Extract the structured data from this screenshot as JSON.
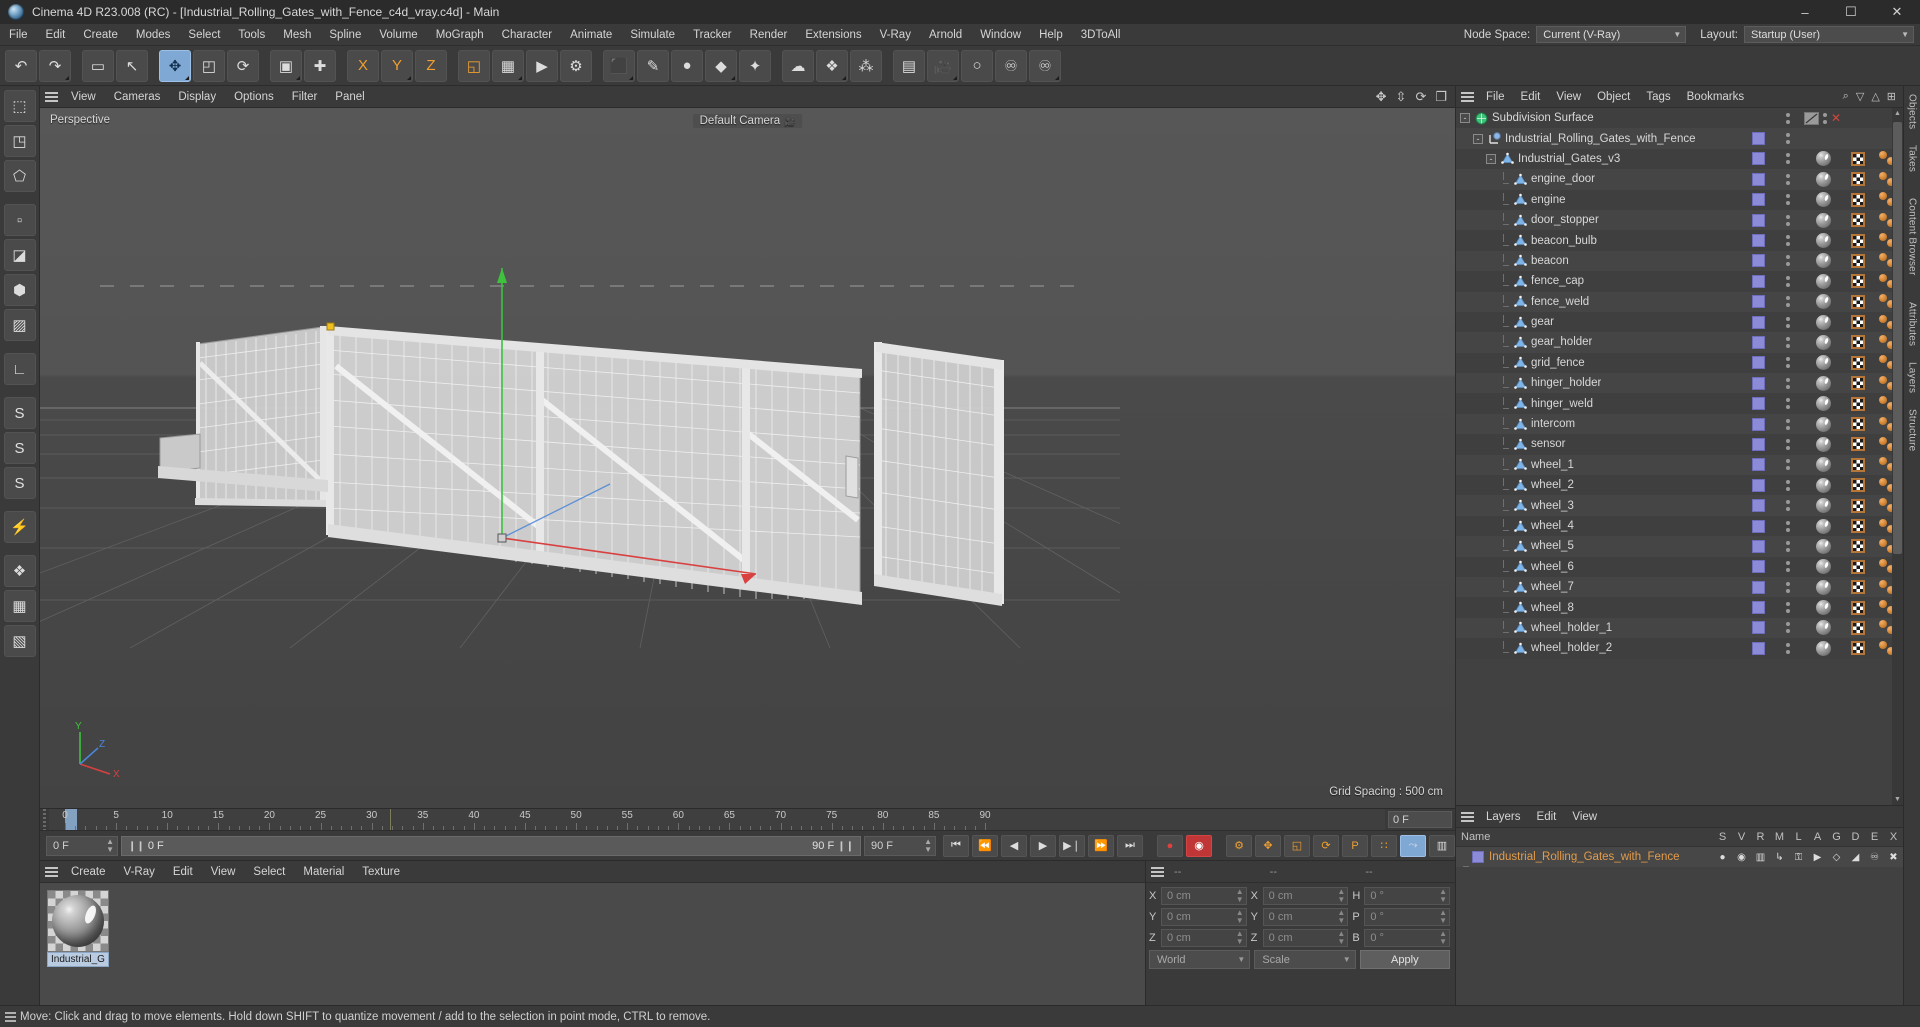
{
  "titlebar": {
    "title": "Cinema 4D R23.008 (RC) - [Industrial_Rolling_Gates_with_Fence_c4d_vray.c4d] - Main",
    "minimize": "–",
    "maximize": "☐",
    "close": "✕"
  },
  "menubar": {
    "items": [
      "File",
      "Edit",
      "Create",
      "Modes",
      "Select",
      "Tools",
      "Mesh",
      "Spline",
      "Volume",
      "MoGraph",
      "Character",
      "Animate",
      "Simulate",
      "Tracker",
      "Render",
      "Extensions",
      "V-Ray",
      "Arnold",
      "Window",
      "Help",
      "3DToAll"
    ],
    "node_space_label": "Node Space:",
    "node_space_value": "Current (V-Ray)",
    "layout_label": "Layout:",
    "layout_value": "Startup (User)"
  },
  "toolbar": {
    "buttons": [
      {
        "name": "undo-button",
        "glyph": "↶"
      },
      {
        "name": "redo-button",
        "glyph": "↷"
      },
      {
        "name": "live-selection-button",
        "glyph": "▭"
      },
      {
        "name": "cursor-select-button",
        "glyph": "↖"
      },
      {
        "name": "move-tool-button",
        "glyph": "✥"
      },
      {
        "name": "scale-tool-button",
        "glyph": "◰"
      },
      {
        "name": "rotate-tool-button",
        "glyph": "⟳"
      },
      {
        "name": "render-region-button",
        "glyph": "▣"
      },
      {
        "name": "world-axis-button",
        "glyph": "✚"
      },
      {
        "name": "x-axis-lock-button",
        "glyph": "X"
      },
      {
        "name": "y-axis-lock-button",
        "glyph": "Y"
      },
      {
        "name": "z-axis-lock-button",
        "glyph": "Z"
      },
      {
        "name": "world-object-coord-button",
        "glyph": "◱"
      },
      {
        "name": "render-view-button",
        "glyph": "▦"
      },
      {
        "name": "render-to-picture-viewer-button",
        "glyph": "▶"
      },
      {
        "name": "render-settings-button",
        "glyph": "⚙"
      },
      {
        "name": "cube-primitive-button",
        "glyph": "⬛"
      },
      {
        "name": "spline-pen-button",
        "glyph": "✎"
      },
      {
        "name": "nurbs-generator-button",
        "glyph": "●"
      },
      {
        "name": "array-modeling-button",
        "glyph": "◆"
      },
      {
        "name": "deformer-button",
        "glyph": "✦"
      },
      {
        "name": "environment-button",
        "glyph": "☁"
      },
      {
        "name": "mograph-button",
        "glyph": "❖"
      },
      {
        "name": "character-button",
        "glyph": "⁂"
      },
      {
        "name": "camera-grid-button",
        "glyph": "▤"
      },
      {
        "name": "camera-button",
        "glyph": "🎥"
      },
      {
        "name": "light-button",
        "glyph": "○"
      },
      {
        "name": "python-script-button",
        "glyph": "♾"
      },
      {
        "name": "python-generator-button",
        "glyph": "♾"
      }
    ]
  },
  "left_palette": {
    "buttons": [
      {
        "name": "model-mode-button",
        "glyph": "⬚"
      },
      {
        "name": "texture-mode-button",
        "glyph": "◳"
      },
      {
        "name": "object-axis-mode-button",
        "glyph": "⬠"
      },
      {
        "name": "point-mode-button",
        "glyph": "▫"
      },
      {
        "name": "edge-mode-button",
        "glyph": "◪"
      },
      {
        "name": "polygon-mode-button",
        "glyph": "⬢"
      },
      {
        "name": "uv-points-mode-button",
        "glyph": "▨"
      },
      {
        "name": "workplane-button",
        "glyph": "∟"
      },
      {
        "name": "snap-enable-button",
        "glyph": "S"
      },
      {
        "name": "snap-quantize-button",
        "glyph": "S"
      },
      {
        "name": "snap-settings-button",
        "glyph": "S"
      },
      {
        "name": "magnet-button",
        "glyph": "⚡"
      },
      {
        "name": "axis-lock-button",
        "glyph": "❖"
      },
      {
        "name": "viewport-solo-button",
        "glyph": "▦"
      },
      {
        "name": "viewport-filter-button",
        "glyph": "▧"
      }
    ]
  },
  "viewport": {
    "menu_items": [
      "View",
      "Cameras",
      "Display",
      "Options",
      "Filter",
      "Panel"
    ],
    "perspective_label": "Perspective",
    "camera_label": "Default Camera",
    "grid_spacing": "Grid Spacing : 500 cm",
    "axis_x_label": "X",
    "axis_y_label": "Y",
    "axis_z_label": "Z",
    "header_icons": [
      {
        "name": "viewport-pan-icon",
        "glyph": "✥"
      },
      {
        "name": "viewport-dolly-icon",
        "glyph": "⇳"
      },
      {
        "name": "viewport-rotate-icon",
        "glyph": "⟳"
      },
      {
        "name": "viewport-maximize-icon",
        "glyph": "❐"
      }
    ]
  },
  "timeline": {
    "ticks": [
      0,
      5,
      10,
      15,
      20,
      25,
      30,
      35,
      40,
      45,
      50,
      55,
      60,
      65,
      70,
      75,
      80,
      85,
      90
    ],
    "current_frame_right": "0 F",
    "start_frame": "0 F",
    "preview_start": "0 F",
    "preview_end": "90 F",
    "end_frame": "90 F",
    "transport": [
      {
        "name": "go-to-start-button",
        "glyph": "⏮"
      },
      {
        "name": "previous-keyframe-button",
        "glyph": "⏪"
      },
      {
        "name": "step-back-button",
        "glyph": "◀"
      },
      {
        "name": "play-button",
        "glyph": "▶"
      },
      {
        "name": "step-forward-button",
        "glyph": "▶❘"
      },
      {
        "name": "next-keyframe-button",
        "glyph": "⏩"
      },
      {
        "name": "go-to-end-button",
        "glyph": "⏭"
      },
      {
        "name": "record-active-objects-button",
        "glyph": "●"
      },
      {
        "name": "autokeying-button",
        "glyph": "◉"
      },
      {
        "name": "keyframe-selection-button",
        "glyph": "⚙"
      },
      {
        "name": "position-key-button",
        "glyph": "✥"
      },
      {
        "name": "scale-key-button",
        "glyph": "◱"
      },
      {
        "name": "rotation-key-button",
        "glyph": "⟳"
      },
      {
        "name": "parameter-key-button",
        "glyph": "P"
      },
      {
        "name": "point-level-animation-button",
        "glyph": "∷"
      },
      {
        "name": "animation-mode-button",
        "glyph": "⤳"
      },
      {
        "name": "timeline-settings-button",
        "glyph": "▥"
      }
    ]
  },
  "material_manager": {
    "menu_items": [
      "Create",
      "V-Ray",
      "Edit",
      "View",
      "Select",
      "Material",
      "Texture"
    ],
    "materials": [
      {
        "name": "Industrial_G",
        "selected": true
      }
    ]
  },
  "coordinates": {
    "col_headers": [
      "--",
      "--",
      "--"
    ],
    "rows": [
      {
        "l1": "X",
        "v1": "0 cm",
        "l2": "X",
        "v2": "0 cm",
        "l3": "H",
        "v3": "0 °"
      },
      {
        "l1": "Y",
        "v1": "0 cm",
        "l2": "Y",
        "v2": "0 cm",
        "l3": "P",
        "v3": "0 °"
      },
      {
        "l1": "Z",
        "v1": "0 cm",
        "l2": "Z",
        "v2": "0 cm",
        "l3": "B",
        "v3": "0 °"
      }
    ],
    "system_select": "World",
    "mode_select": "Scale",
    "apply_button": "Apply"
  },
  "object_manager": {
    "menu_items": [
      "File",
      "Edit",
      "View",
      "Object",
      "Tags",
      "Bookmarks"
    ],
    "header_icons": [
      {
        "name": "search-icon",
        "glyph": "⌕"
      },
      {
        "name": "filter-icon",
        "glyph": "▽"
      },
      {
        "name": "sort-icon",
        "glyph": "△"
      },
      {
        "name": "expand-icon",
        "glyph": "⊞"
      }
    ],
    "objects": [
      {
        "label": "Subdivision Surface",
        "depth": 0,
        "icon": "subdivision-surface-icon",
        "expander": "-",
        "tags": false,
        "layer": false
      },
      {
        "label": "Industrial_Rolling_Gates_with_Fence",
        "depth": 1,
        "icon": "null-object-icon",
        "expander": "-",
        "tags": false,
        "layer": true
      },
      {
        "label": "Industrial_Gates_v3",
        "depth": 2,
        "icon": "polygon-object-icon",
        "expander": "-",
        "tags": true,
        "layer": true
      },
      {
        "label": "engine_door",
        "depth": 3,
        "icon": "polygon-object-icon",
        "expander": "",
        "tags": true,
        "layer": true
      },
      {
        "label": "engine",
        "depth": 3,
        "icon": "polygon-object-icon",
        "expander": "",
        "tags": true,
        "layer": true
      },
      {
        "label": "door_stopper",
        "depth": 3,
        "icon": "polygon-object-icon",
        "expander": "",
        "tags": true,
        "layer": true
      },
      {
        "label": "beacon_bulb",
        "depth": 3,
        "icon": "polygon-object-icon",
        "expander": "",
        "tags": true,
        "layer": true
      },
      {
        "label": "beacon",
        "depth": 3,
        "icon": "polygon-object-icon",
        "expander": "",
        "tags": true,
        "layer": true
      },
      {
        "label": "fence_cap",
        "depth": 3,
        "icon": "polygon-object-icon",
        "expander": "",
        "tags": true,
        "layer": true
      },
      {
        "label": "fence_weld",
        "depth": 3,
        "icon": "polygon-object-icon",
        "expander": "",
        "tags": true,
        "layer": true
      },
      {
        "label": "gear",
        "depth": 3,
        "icon": "polygon-object-icon",
        "expander": "",
        "tags": true,
        "layer": true
      },
      {
        "label": "gear_holder",
        "depth": 3,
        "icon": "polygon-object-icon",
        "expander": "",
        "tags": true,
        "layer": true
      },
      {
        "label": "grid_fence",
        "depth": 3,
        "icon": "polygon-object-icon",
        "expander": "",
        "tags": true,
        "layer": true
      },
      {
        "label": "hinger_holder",
        "depth": 3,
        "icon": "polygon-object-icon",
        "expander": "",
        "tags": true,
        "layer": true
      },
      {
        "label": "hinger_weld",
        "depth": 3,
        "icon": "polygon-object-icon",
        "expander": "",
        "tags": true,
        "layer": true
      },
      {
        "label": "intercom",
        "depth": 3,
        "icon": "polygon-object-icon",
        "expander": "",
        "tags": true,
        "layer": true
      },
      {
        "label": "sensor",
        "depth": 3,
        "icon": "polygon-object-icon",
        "expander": "",
        "tags": true,
        "layer": true
      },
      {
        "label": "wheel_1",
        "depth": 3,
        "icon": "polygon-object-icon",
        "expander": "",
        "tags": true,
        "layer": true
      },
      {
        "label": "wheel_2",
        "depth": 3,
        "icon": "polygon-object-icon",
        "expander": "",
        "tags": true,
        "layer": true
      },
      {
        "label": "wheel_3",
        "depth": 3,
        "icon": "polygon-object-icon",
        "expander": "",
        "tags": true,
        "layer": true
      },
      {
        "label": "wheel_4",
        "depth": 3,
        "icon": "polygon-object-icon",
        "expander": "",
        "tags": true,
        "layer": true
      },
      {
        "label": "wheel_5",
        "depth": 3,
        "icon": "polygon-object-icon",
        "expander": "",
        "tags": true,
        "layer": true
      },
      {
        "label": "wheel_6",
        "depth": 3,
        "icon": "polygon-object-icon",
        "expander": "",
        "tags": true,
        "layer": true
      },
      {
        "label": "wheel_7",
        "depth": 3,
        "icon": "polygon-object-icon",
        "expander": "",
        "tags": true,
        "layer": true
      },
      {
        "label": "wheel_8",
        "depth": 3,
        "icon": "polygon-object-icon",
        "expander": "",
        "tags": true,
        "layer": true
      },
      {
        "label": "wheel_holder_1",
        "depth": 3,
        "icon": "polygon-object-icon",
        "expander": "",
        "tags": true,
        "layer": true
      },
      {
        "label": "wheel_holder_2",
        "depth": 3,
        "icon": "polygon-object-icon",
        "expander": "",
        "tags": true,
        "layer": true
      }
    ]
  },
  "layers_manager": {
    "menu_items": [
      "Layers",
      "Edit",
      "View"
    ],
    "columns": [
      "Name",
      "S",
      "V",
      "R",
      "M",
      "L",
      "A",
      "G",
      "D",
      "E",
      "X"
    ],
    "rows": [
      {
        "name": "Industrial_Rolling_Gates_with_Fence",
        "flags": [
          "●",
          "◉",
          "▥",
          "↳",
          "⚿",
          "▶",
          "◇",
          "◢",
          "♾",
          "✖"
        ]
      }
    ]
  },
  "right_tabs": [
    "Objects",
    "Takes",
    "Content Browser",
    "Attributes",
    "Layers",
    "Structure"
  ],
  "statusbar": {
    "text": "Move: Click and drag to move elements. Hold down SHIFT to quantize movement / add to the selection in point mode, CTRL to remove."
  },
  "colors": {
    "accent_blue": "#7fa8d4",
    "layer_purple": "#8b8bd8",
    "layer_orange": "#e39b4a",
    "axis_x": "#d04040",
    "axis_y": "#40c040",
    "axis_z": "#4080d0"
  }
}
